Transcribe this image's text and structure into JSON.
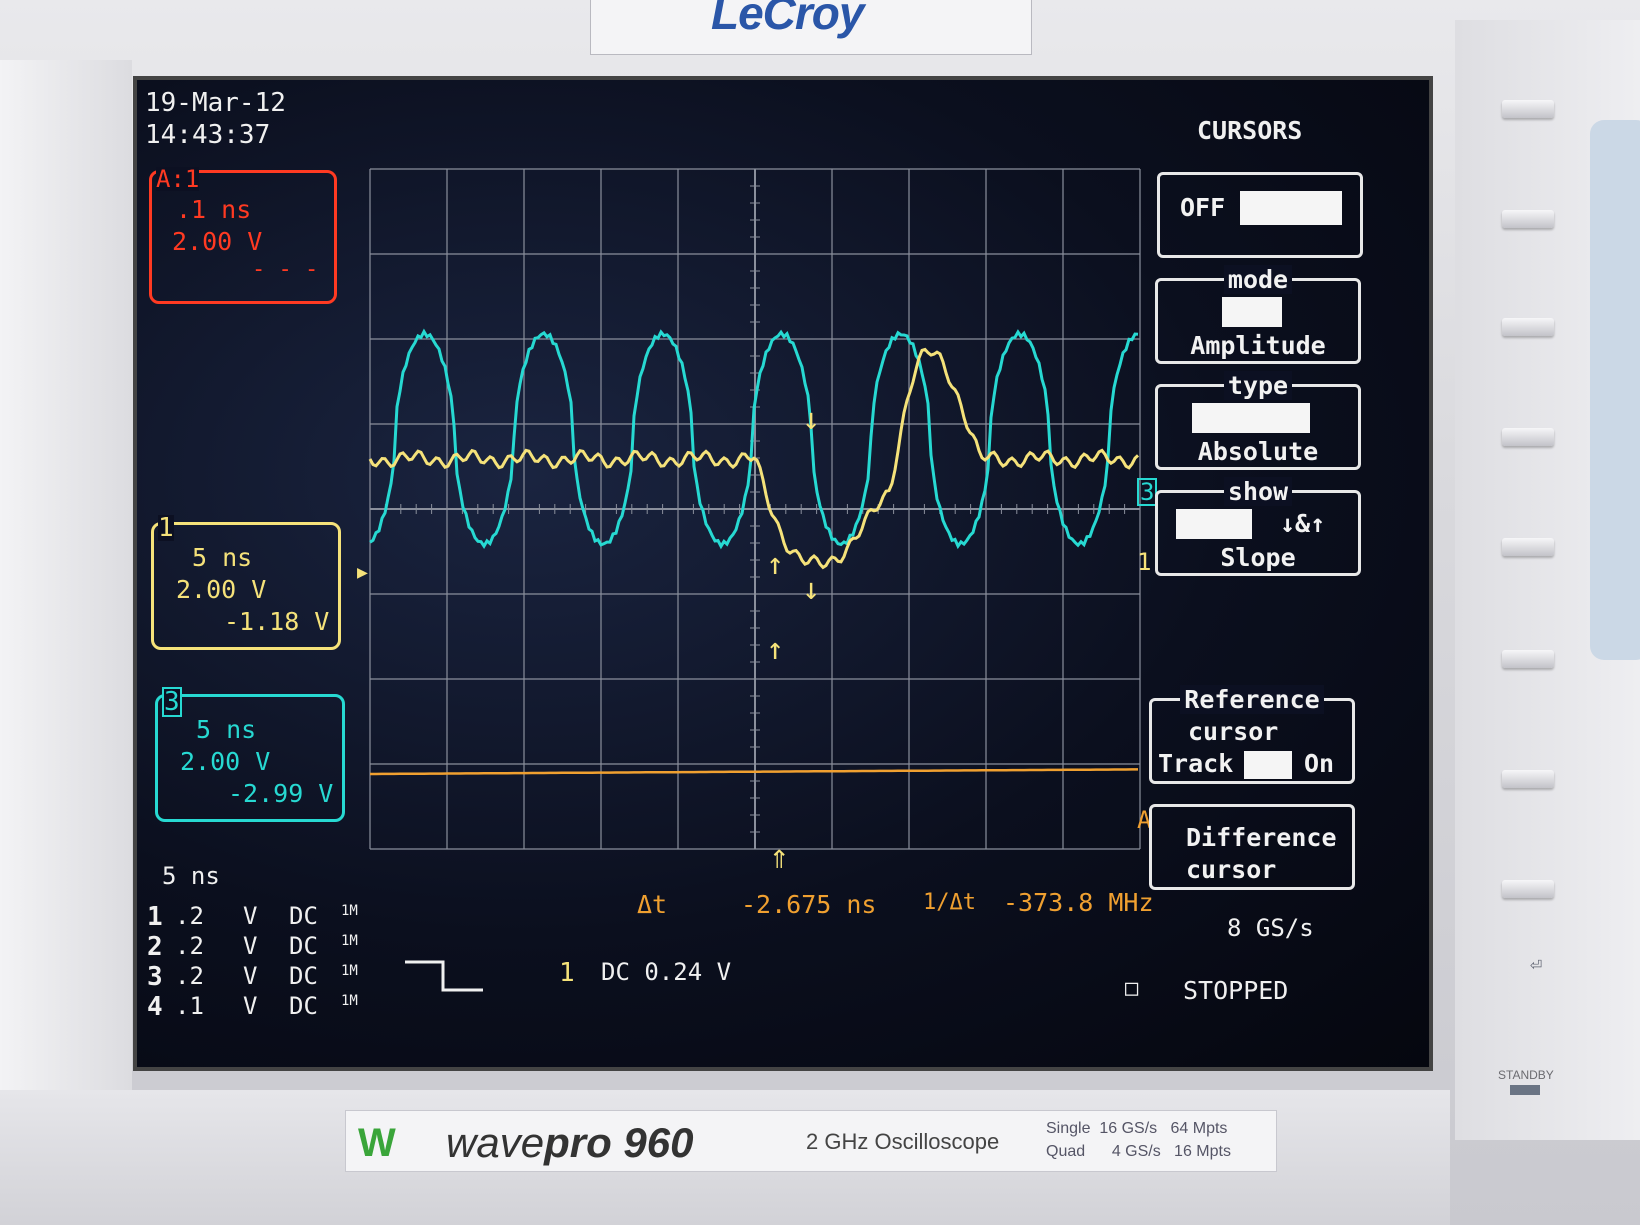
{
  "brand": "LeCroy",
  "header": {
    "date": "19-Mar-12",
    "time": "14:43:37"
  },
  "trace_a": {
    "label": "A:1",
    "timebase": ".1 ns",
    "volts": "2.00 V",
    "offset": "- - -"
  },
  "trace_1": {
    "label": "1",
    "timebase": "5 ns",
    "volts": "2.00 V",
    "offset": "-1.18 V"
  },
  "trace_3": {
    "label": "3",
    "timebase": "5 ns",
    "volts": "2.00 V",
    "offset": "-2.99 V"
  },
  "channels": {
    "timebase": "5 ns",
    "rows": [
      {
        "num": "1",
        "scale": ".2",
        "unit": "V",
        "coupling": "DC",
        "impedance": "1M"
      },
      {
        "num": "2",
        "scale": ".2",
        "unit": "V",
        "coupling": "DC",
        "impedance": "1M"
      },
      {
        "num": "3",
        "scale": ".2",
        "unit": "V",
        "coupling": "DC",
        "impedance": "1M"
      },
      {
        "num": "4",
        "scale": ".1",
        "unit": "V",
        "coupling": "DC",
        "impedance": "1M"
      }
    ]
  },
  "measurements": {
    "delta_t_label": "Δt",
    "delta_t": "-2.675 ns",
    "inv_label": "1/Δt",
    "inv": "-373.8 MHz"
  },
  "trigger": {
    "source": "1",
    "coupling": "DC 0.24 V"
  },
  "acquisition": {
    "sample_rate": "8 GS/s",
    "status": "STOPPED"
  },
  "grid_markers": {
    "ch3": "3",
    "ch1": "1",
    "a": "A"
  },
  "menu": {
    "title": "CURSORS",
    "cursors": {
      "off": "OFF"
    },
    "mode": {
      "title": "mode",
      "value": "Amplitude"
    },
    "type": {
      "title": "type",
      "value": "Absolute"
    },
    "show": {
      "title": "show",
      "arrows": "↓&↑",
      "value": "Slope"
    },
    "reference": {
      "title": "Reference",
      "line2": "cursor",
      "track": "Track",
      "on": "On"
    },
    "difference": {
      "line1": "Difference",
      "line2": "cursor"
    }
  },
  "panel": {
    "standby": "STANDBY"
  },
  "model": {
    "logo": "W",
    "name_prefix": "wave",
    "name_bold": "pro",
    "number": "960",
    "desc": "2 GHz Oscilloscope",
    "spec_single": "Single  16 GS/s   64 Mpts",
    "spec_quad": "Quad      4 GS/s   16 Mpts"
  },
  "colors": {
    "ch1": "#f5e27a",
    "ch3": "#27d9d2",
    "math_a": "#ff3a22",
    "ref": "#f0a030",
    "grid": "#8a8f9c"
  }
}
